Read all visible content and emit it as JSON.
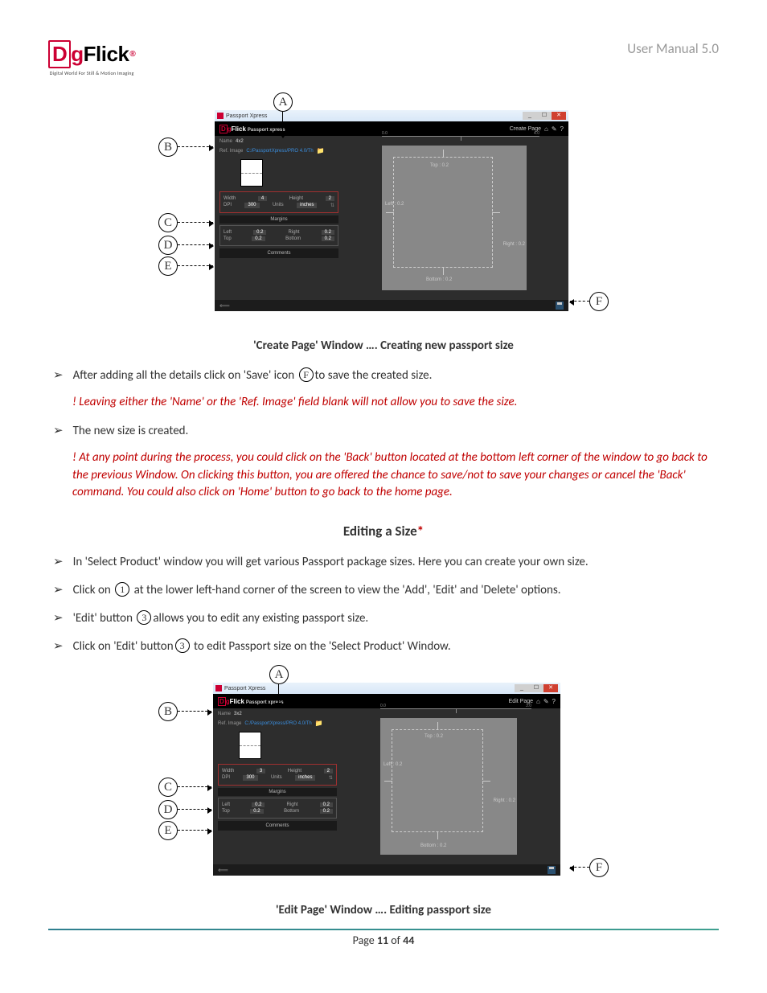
{
  "header": {
    "logo_tagline": "Digital World For Still & Motion Imaging",
    "manual_title": "User Manual 5.0"
  },
  "figure1": {
    "window_title": "Passport Xpress",
    "app_sub": "Passport xpress",
    "action_label": "Create Page",
    "name_label": "Name",
    "name_value": "4x2",
    "ref_label": "Ref. Image",
    "ref_value": "C:/PassportXpress/PRO 4.0/Th",
    "width_label": "Width",
    "width_value": "4",
    "height_label": "Height",
    "height_value": "2",
    "ppi_label": "DPI",
    "ppi_value": "300",
    "units_label": "Units",
    "units_value": "inches",
    "margins_header": "Margins",
    "m_left_label": "Left",
    "m_left_value": "0.2",
    "m_right_label": "Right",
    "m_right_value": "0.2",
    "m_top_label": "Top",
    "m_top_value": "0.2",
    "m_bottom_label": "Bottom",
    "m_bottom_value": "0.2",
    "comments_header": "Comments",
    "preview": {
      "ruler_min": "0.0",
      "ruler_max": "4.0",
      "top_label": "Top : 0.2",
      "left_label": "Left : 0.2",
      "right_label": "Right : 0.2",
      "bottom_label": "Bottom : 0.2"
    },
    "callouts": {
      "A": "A",
      "B": "B",
      "C": "C",
      "D": "D",
      "E": "E",
      "F": "F"
    },
    "caption": "'Create Page' Window …. Creating new passport size"
  },
  "bullets1": {
    "b1_pre": "After adding all the details click on 'Save' icon ",
    "b1_circ": "F",
    "b1_post": "to save the created size.",
    "warn1": "! Leaving either the 'Name' or the 'Ref. Image' field blank will not allow you to save the size.",
    "b2": "The new size is created.",
    "warn2": "! At any point during the process, you could click on the 'Back' button located at the bottom left corner of the window to go back to the previous Window. On clicking this button, you are offered the chance to save/not to save your changes or cancel the 'Back' command. You could also click on 'Home' button to go back to the home page."
  },
  "section2_heading": "Editing a Size",
  "bullets2": {
    "b1": "In 'Select Product' window you will get various Passport package sizes. Here you can create your own size.",
    "b2_pre": "Click on ",
    "b2_circ": "1",
    "b2_post": " at the lower left-hand corner of the screen to view the 'Add', 'Edit' and 'Delete' options.",
    "b3_pre": "'Edit' button ",
    "b3_circ": "3",
    "b3_post": "allows you to edit any existing passport size.",
    "b4_pre": "Click on 'Edit' button",
    "b4_circ": "3",
    "b4_post": " to edit Passport size on the 'Select Product' Window."
  },
  "figure2": {
    "window_title": "Passport Xpress",
    "app_sub": "Passport xpress",
    "action_label": "Edit Page",
    "name_label": "Name",
    "name_value": "3x2",
    "ref_label": "Ref. Image",
    "ref_value": "C:/PassportXpress/PRO 4.0/Th",
    "width_label": "Width",
    "width_value": "3",
    "height_label": "Height",
    "height_value": "2",
    "ppi_label": "DPI",
    "ppi_value": "300",
    "units_label": "Units",
    "units_value": "inches",
    "margins_header": "Margins",
    "m_left_label": "Left",
    "m_left_value": "0.2",
    "m_right_label": "Right",
    "m_right_value": "0.2",
    "m_top_label": "Top",
    "m_top_value": "0.2",
    "m_bottom_label": "Bottom",
    "m_bottom_value": "0.2",
    "comments_header": "Comments",
    "preview": {
      "ruler_min": "0.0",
      "ruler_max": "3.0",
      "top_label": "Top : 0.2",
      "left_label": "Left : 0.2",
      "right_label": "Right : 0.2",
      "bottom_label": "Bottom : 0.2"
    },
    "callouts": {
      "A": "A",
      "B": "B",
      "C": "C",
      "D": "D",
      "E": "E",
      "F": "F"
    },
    "caption": "'Edit Page' Window …. Editing passport size"
  },
  "footer": {
    "page_label_pre": "Page ",
    "page_num": "11",
    "page_of": " of ",
    "page_total": "44"
  }
}
